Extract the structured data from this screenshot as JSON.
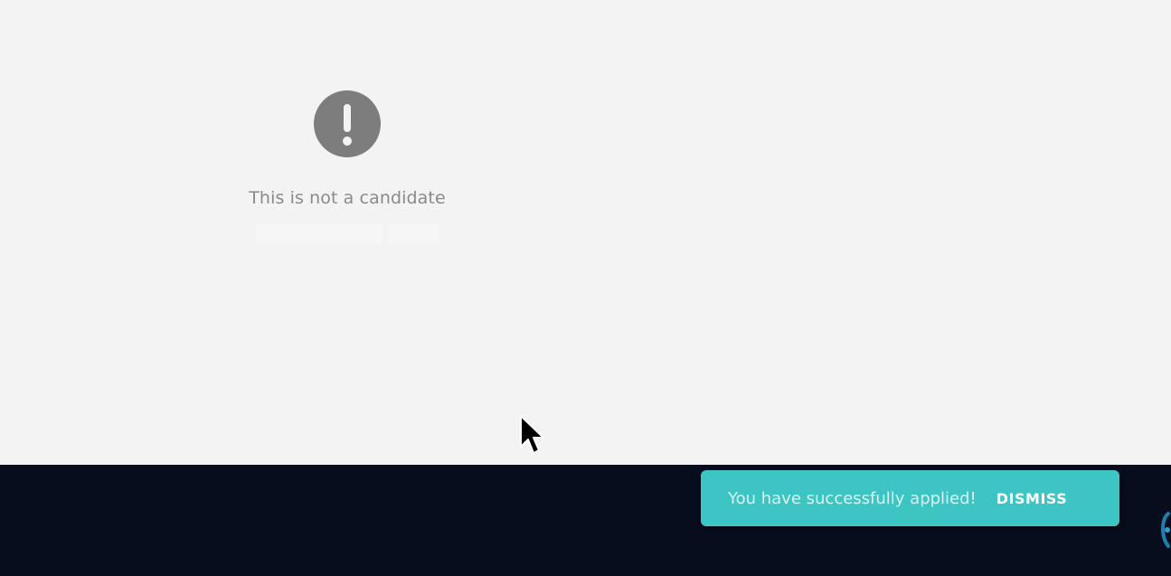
{
  "notice": {
    "icon": "exclamation-circle-icon",
    "message": "This is not a candidate"
  },
  "toast": {
    "message": "You have successfully applied!",
    "dismiss_label": "DISMISS",
    "color": "#3cc5c2"
  },
  "footer": {
    "color": "#080d1e"
  },
  "pointer": {
    "icon": "mouse-cursor-icon"
  }
}
